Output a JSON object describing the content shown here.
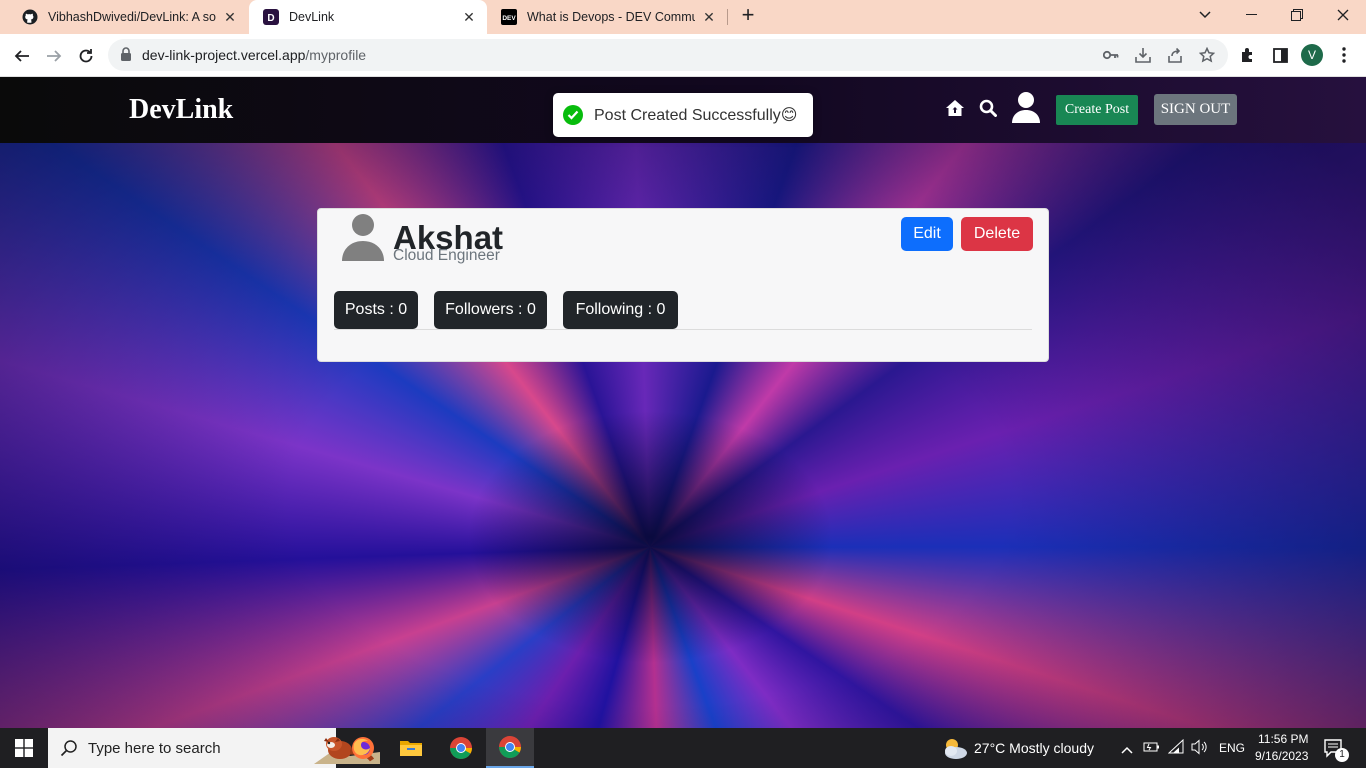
{
  "browser": {
    "tabs": [
      {
        "title": "VibhashDwivedi/DevLink: A socia",
        "favicon": "github-icon",
        "active": false
      },
      {
        "title": "DevLink",
        "favicon": "devlink-favicon",
        "active": true
      },
      {
        "title": "What is Devops - DEV Communit",
        "favicon": "dev-favicon",
        "active": false
      }
    ],
    "url_host": "dev-link-project.vercel.app",
    "url_path": "/myprofile",
    "profile_initial": "V"
  },
  "navbar": {
    "brand": "DevLink",
    "create_post_label": "Create Post",
    "sign_out_label": "SIGN OUT"
  },
  "toast": {
    "message": "Post Created Successfully😊"
  },
  "profile": {
    "name": "Akshat",
    "role": "Cloud Engineer",
    "edit_label": "Edit",
    "delete_label": "Delete",
    "posts_label": "Posts : 0",
    "followers_label": "Followers : 0",
    "following_label": "Following : 0"
  },
  "taskbar": {
    "search_placeholder": "Type here to search",
    "weather": "27°C  Mostly cloudy",
    "language": "ENG",
    "time": "11:56 PM",
    "date": "9/16/2023",
    "notification_count": "1"
  },
  "colors": {
    "create_post": "#198754",
    "sign_out": "#6c757d",
    "edit": "#0d6efd",
    "delete": "#dc3545",
    "stat_badge": "#212529",
    "toast_success": "#07bc0c"
  }
}
